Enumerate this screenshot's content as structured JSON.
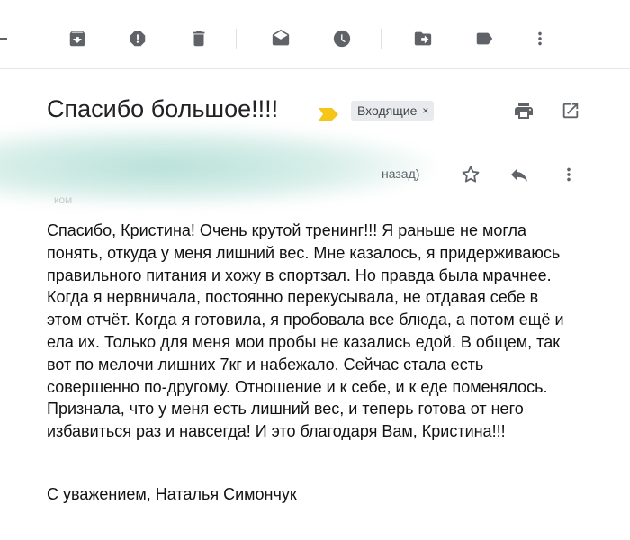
{
  "toolbar": {
    "buttons": [
      {
        "name": "archive-icon"
      },
      {
        "name": "report-spam-icon"
      },
      {
        "name": "delete-icon"
      },
      {
        "name": "mark-unread-icon"
      },
      {
        "name": "snooze-icon"
      },
      {
        "name": "move-to-icon"
      },
      {
        "name": "label-icon"
      },
      {
        "name": "more-vert-icon"
      }
    ]
  },
  "message": {
    "subject": "Спасибо большое!!!!",
    "label": "Входящие",
    "label_close": "×",
    "time_fragment": "назад)",
    "to_fragment": "ком",
    "body": "Спасибо, Кристина! Очень крутой тренинг!!! Я раньше не могла понять, откуда у меня лишний вес. Мне казалось, я придерживаюсь правильного питания и хожу в спортзал. Но правда была мрачнее. Когда я нервничала, постоянно перекусывала, не отдавая себе в этом отчёт. Когда я готовила, я пробовала все блюда, а потом ещё и ела их. Только для меня мои пробы не казались едой. В общем, так вот по мелочи лишних 7кг и набежало. Сейчас стала есть совершенно по-другому. Отношение и к себе, и к еде поменялось. Признала, что у меня есть лишний вес, и теперь готова от него избавиться раз и навсегда! И это благодаря Вам, Кристина!!!",
    "signature": "С уважением, Наталья Симончук"
  },
  "colors": {
    "icon": "#5f6368",
    "importance": "#f5c518",
    "chip_bg": "#e8eaed"
  }
}
